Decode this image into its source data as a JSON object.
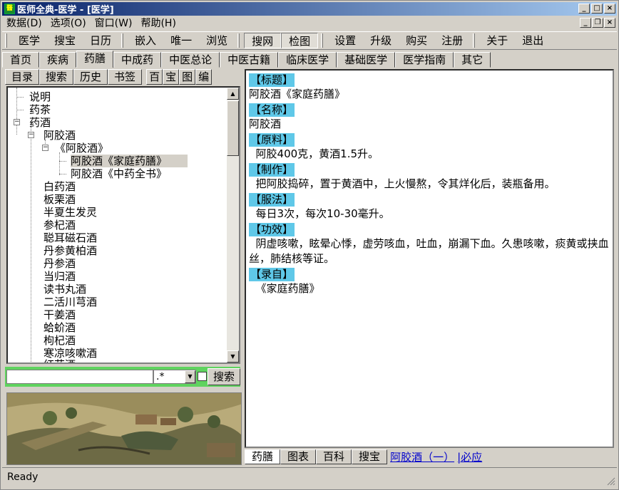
{
  "window": {
    "title": "医师全典-医学 - [医学]",
    "app_icon_text": "醫"
  },
  "menubar": [
    "数据(D)",
    "选项(O)",
    "窗口(W)",
    "帮助(H)"
  ],
  "toolbar": {
    "group1": [
      "医学",
      "搜宝",
      "日历"
    ],
    "group2": [
      "嵌入",
      "唯一",
      "浏览"
    ],
    "group3": [
      "搜网",
      "检图"
    ],
    "group4": [
      "设置",
      "升级",
      "购买",
      "注册"
    ],
    "group5": [
      "关于",
      "退出"
    ]
  },
  "main_tabs": [
    "首页",
    "疾病",
    "药膳",
    "中成药",
    "中医总论",
    "中医古籍",
    "临床医学",
    "基础医学",
    "医学指南",
    "其它"
  ],
  "active_main_tab": "药膳",
  "left_tabs": [
    "目录",
    "搜索",
    "历史",
    "书签"
  ],
  "left_small_tabs": [
    "百",
    "宝",
    "图",
    "编"
  ],
  "tree": {
    "items": [
      {
        "label": "说明"
      },
      {
        "label": "药茶"
      },
      {
        "label": "药酒"
      },
      {
        "label": "阿胶酒"
      },
      {
        "label": "《阿胶酒》"
      },
      {
        "label": "阿胶酒《家庭药膳》",
        "selected": true
      },
      {
        "label": "阿胶酒《中药全书》"
      },
      {
        "label": "白药酒"
      },
      {
        "label": "板栗酒"
      },
      {
        "label": "半夏生发灵"
      },
      {
        "label": "参杞酒"
      },
      {
        "label": "聪耳磁石酒"
      },
      {
        "label": "丹参黄柏酒"
      },
      {
        "label": "丹参酒"
      },
      {
        "label": "当归酒"
      },
      {
        "label": "读书丸酒"
      },
      {
        "label": "二活川芎酒"
      },
      {
        "label": "干姜酒"
      },
      {
        "label": "蛤蚧酒"
      },
      {
        "label": "枸杞酒"
      },
      {
        "label": "寒凉咳嗽酒"
      },
      {
        "label": "红花酒"
      }
    ]
  },
  "search": {
    "value": "",
    "combo_value": ".*",
    "button": "搜索"
  },
  "content": {
    "sections": [
      {
        "heading": "【标题】",
        "text": "阿胶酒《家庭药膳》"
      },
      {
        "heading": "【名称】",
        "text": "阿胶酒"
      },
      {
        "heading": "【原料】",
        "text": "  阿胶400克，黄酒1.5升。"
      },
      {
        "heading": "【制作】",
        "text": "  把阿胶捣碎，置于黄酒中，上火慢熬，令其烊化后，装瓶备用。"
      },
      {
        "heading": "【服法】",
        "text": "  每日3次，每次10-30毫升。"
      },
      {
        "heading": "【功效】",
        "text": "  阴虚咳嗽，眩晕心悸，虚劳咳血，吐血，崩漏下血。久患咳嗽，痰黄或挟血丝，肺结核等证。"
      },
      {
        "heading": "【录自】",
        "text": "  《家庭药膳》"
      }
    ]
  },
  "bottom_tabs": [
    "药膳",
    "图表",
    "百科",
    "搜宝"
  ],
  "bottom_links": [
    "阿胶酒（一）",
    "|必应"
  ],
  "status": "Ready",
  "colors": {
    "section_bg": "#5fc8e8",
    "search_bar_bg": "#5fd35f",
    "title_gradient_start": "#0a246a"
  }
}
